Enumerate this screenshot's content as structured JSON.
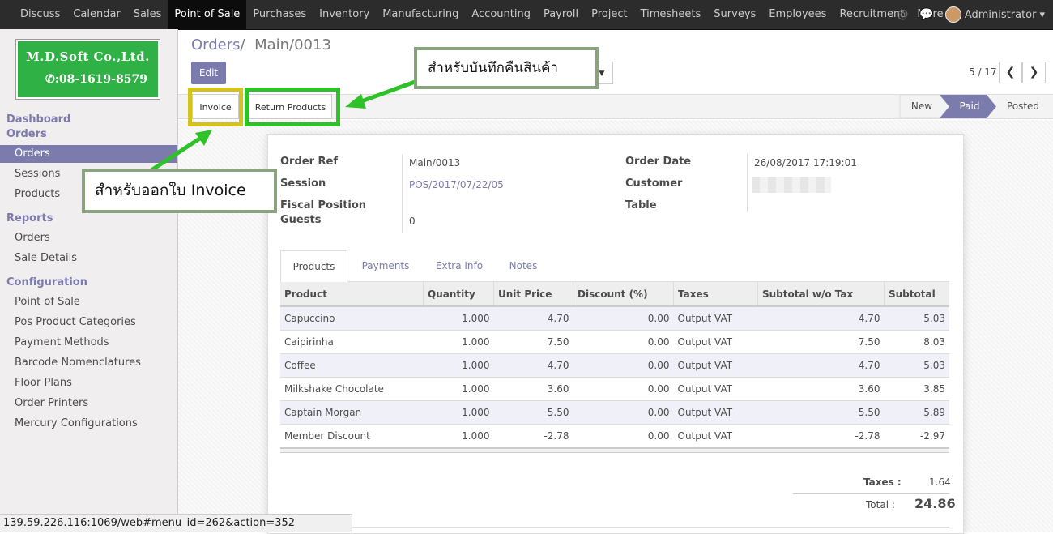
{
  "topnav": {
    "items": [
      "Discuss",
      "Calendar",
      "Sales",
      "Point of Sale",
      "Purchases",
      "Inventory",
      "Manufacturing",
      "Accounting",
      "Payroll",
      "Project",
      "Timesheets",
      "Surveys",
      "Employees",
      "Recruitment",
      "More"
    ],
    "active": "Point of Sale",
    "user": "Administrator"
  },
  "logo": {
    "company": "M.D.Soft Co.,Ltd.",
    "phone": "08-1619-8579"
  },
  "sidebar": {
    "sections": [
      {
        "heading": "Dashboard"
      },
      {
        "heading": "Orders",
        "items": [
          "Orders",
          "Sessions",
          "Products"
        ]
      },
      {
        "heading": "Reports",
        "items": [
          "Orders",
          "Sale Details"
        ]
      },
      {
        "heading": "Configuration",
        "items": [
          "Point of Sale",
          "Pos Product Categories",
          "Payment Methods",
          "Barcode Nomenclatures",
          "Floor Plans",
          "Order Printers",
          "Mercury Configurations"
        ]
      }
    ],
    "active_item": "Orders"
  },
  "breadcrumb": {
    "parent": "Orders",
    "sep": "/",
    "current": "Main/0013"
  },
  "buttons": {
    "edit": "Edit",
    "invoice": "Invoice",
    "return_products": "Return Products"
  },
  "pager": {
    "text": "5 / 17"
  },
  "stages": [
    "New",
    "Paid",
    "Posted"
  ],
  "active_stage": "Paid",
  "form": {
    "order_ref_label": "Order Ref",
    "order_ref": "Main/0013",
    "session_label": "Session",
    "session": "POS/2017/07/22/05",
    "fiscal_label": "Fiscal Position",
    "guests_label": "Guests",
    "guests": "0",
    "order_date_label": "Order Date",
    "order_date": "26/08/2017 17:19:01",
    "customer_label": "Customer",
    "table_label": "Table"
  },
  "tabs": [
    "Products",
    "Payments",
    "Extra Info",
    "Notes"
  ],
  "active_tab": "Products",
  "lines": {
    "headers": [
      "Product",
      "Quantity",
      "Unit Price",
      "Discount (%)",
      "Taxes",
      "Subtotal w/o Tax",
      "Subtotal"
    ],
    "rows": [
      [
        "Capuccino",
        "1.000",
        "4.70",
        "0.00",
        "Output VAT",
        "4.70",
        "5.03"
      ],
      [
        "Caipirinha",
        "1.000",
        "7.50",
        "0.00",
        "Output VAT",
        "7.50",
        "8.03"
      ],
      [
        "Coffee",
        "1.000",
        "4.70",
        "0.00",
        "Output VAT",
        "4.70",
        "5.03"
      ],
      [
        "Milkshake Chocolate",
        "1.000",
        "3.60",
        "0.00",
        "Output VAT",
        "3.60",
        "3.85"
      ],
      [
        "Captain Morgan",
        "1.000",
        "5.50",
        "0.00",
        "Output VAT",
        "5.50",
        "5.89"
      ],
      [
        "Member Discount",
        "1.000",
        "-2.78",
        "0.00",
        "Output VAT",
        "-2.78",
        "-2.97"
      ]
    ]
  },
  "totals": {
    "taxes_label": "Taxes :",
    "taxes": "1.64",
    "total_label": "Total :",
    "total": "24.86"
  },
  "status_url": "139.59.226.116:1069/web#menu_id=262&action=352",
  "annotations": {
    "return_note": "สำหรับบันทึกคืนสินค้า",
    "invoice_note": "สำหรับออกใบ Invoice"
  },
  "colors": {
    "accent": "#7c7bad",
    "highlight_yellow": "#d4c21d",
    "highlight_green": "#2ec228",
    "callout_border": "#8aa27d"
  }
}
